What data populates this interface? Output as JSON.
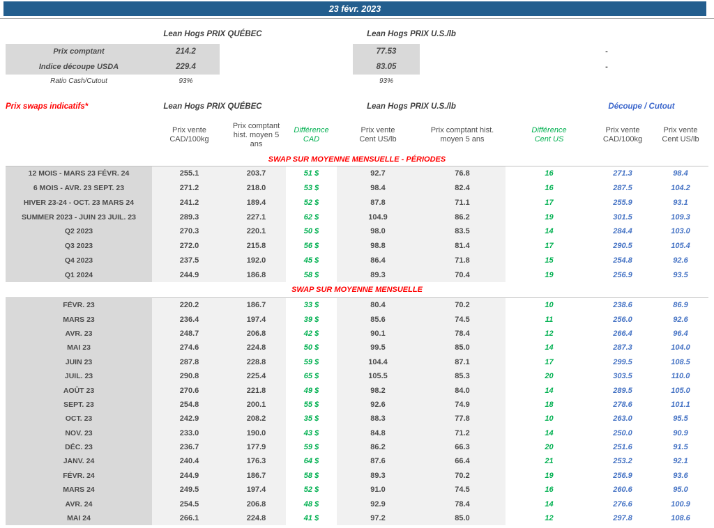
{
  "title_bar": {
    "date": "23 févr. 2023"
  },
  "colors": {
    "header_bar_blue": "#235e8e",
    "difference_green": "#00b050",
    "cutout_blue": "#4472c4",
    "section_red": "#ff0000",
    "label_gray_bg": "#d9d9d9",
    "value_gray_bg": "#f1f1f1"
  },
  "spot": {
    "quebec_header": "Lean Hogs PRIX QUÉBEC",
    "us_header": "Lean Hogs PRIX U.S./lb",
    "rows": [
      {
        "label": "Prix comptant",
        "quebec": "214.2",
        "us": "77.53",
        "right": "-"
      },
      {
        "label": "Indice découpe USDA",
        "quebec": "229.4",
        "us": "83.05",
        "right": "-"
      },
      {
        "label": "Ratio Cash/Cutout",
        "quebec": "93%",
        "us": "93%",
        "right": ""
      }
    ]
  },
  "swaps": {
    "label": "Prix swaps indicatifs*",
    "quebec_header": "Lean Hogs PRIX QUÉBEC",
    "us_header": "Lean Hogs PRIX U.S./lb",
    "cutout_header": "Découpe / Cutout",
    "columns": [
      "Prix vente\nCAD/100kg",
      "Prix comptant\nhist. moyen 5\nans",
      "Différence\nCAD",
      "Prix vente\nCent US/lb",
      "Prix comptant hist.\nmoyen 5 ans",
      "Différence\nCent US",
      "Prix vente\nCAD/100kg",
      "Prix vente\nCent US/lb"
    ],
    "sections": [
      {
        "title": "SWAP SUR MOYENNE MENSUELLE - PÉRIODES",
        "rows": [
          [
            "12 MOIS - MARS 23 FÉVR. 24",
            "255.1",
            "203.7",
            "51 $",
            "92.7",
            "76.8",
            "16",
            "271.3",
            "98.4"
          ],
          [
            "6 MOIS - AVR. 23 SEPT. 23",
            "271.2",
            "218.0",
            "53 $",
            "98.4",
            "82.4",
            "16",
            "287.5",
            "104.2"
          ],
          [
            "HIVER 23-24 - OCT. 23 MARS 24",
            "241.2",
            "189.4",
            "52 $",
            "87.8",
            "71.1",
            "17",
            "255.9",
            "93.1"
          ],
          [
            "SUMMER 2023 - JUIN 23 JUIL. 23",
            "289.3",
            "227.1",
            "62 $",
            "104.9",
            "86.2",
            "19",
            "301.5",
            "109.3"
          ],
          [
            "Q2 2023",
            "270.3",
            "220.1",
            "50 $",
            "98.0",
            "83.5",
            "14",
            "284.4",
            "103.0"
          ],
          [
            "Q3 2023",
            "272.0",
            "215.8",
            "56 $",
            "98.8",
            "81.4",
            "17",
            "290.5",
            "105.4"
          ],
          [
            "Q4 2023",
            "237.5",
            "192.0",
            "45 $",
            "86.4",
            "71.8",
            "15",
            "254.8",
            "92.6"
          ],
          [
            "Q1 2024",
            "244.9",
            "186.8",
            "58 $",
            "89.3",
            "70.4",
            "19",
            "256.9",
            "93.5"
          ]
        ]
      },
      {
        "title": "SWAP SUR MOYENNE MENSUELLE",
        "rows": [
          [
            "FÉVR. 23",
            "220.2",
            "186.7",
            "33 $",
            "80.4",
            "70.2",
            "10",
            "238.6",
            "86.9"
          ],
          [
            "MARS 23",
            "236.4",
            "197.4",
            "39 $",
            "85.6",
            "74.5",
            "11",
            "256.0",
            "92.6"
          ],
          [
            "AVR. 23",
            "248.7",
            "206.8",
            "42 $",
            "90.1",
            "78.4",
            "12",
            "266.4",
            "96.4"
          ],
          [
            "MAI 23",
            "274.6",
            "224.8",
            "50 $",
            "99.5",
            "85.0",
            "14",
            "287.3",
            "104.0"
          ],
          [
            "JUIN 23",
            "287.8",
            "228.8",
            "59 $",
            "104.4",
            "87.1",
            "17",
            "299.5",
            "108.5"
          ],
          [
            "JUIL. 23",
            "290.8",
            "225.4",
            "65 $",
            "105.5",
            "85.3",
            "20",
            "303.5",
            "110.0"
          ],
          [
            "AOÛT 23",
            "270.6",
            "221.8",
            "49 $",
            "98.2",
            "84.0",
            "14",
            "289.5",
            "105.0"
          ],
          [
            "SEPT. 23",
            "254.8",
            "200.1",
            "55 $",
            "92.6",
            "74.9",
            "18",
            "278.6",
            "101.1"
          ],
          [
            "OCT. 23",
            "242.9",
            "208.2",
            "35 $",
            "88.3",
            "77.8",
            "10",
            "263.0",
            "95.5"
          ],
          [
            "NOV. 23",
            "233.0",
            "190.0",
            "43 $",
            "84.8",
            "71.2",
            "14",
            "250.0",
            "90.9"
          ],
          [
            "DÉC. 23",
            "236.7",
            "177.9",
            "59 $",
            "86.2",
            "66.3",
            "20",
            "251.6",
            "91.5"
          ],
          [
            "JANV. 24",
            "240.4",
            "176.3",
            "64 $",
            "87.6",
            "66.4",
            "21",
            "253.2",
            "92.1"
          ],
          [
            "FÉVR. 24",
            "244.9",
            "186.7",
            "58 $",
            "89.3",
            "70.2",
            "19",
            "256.9",
            "93.6"
          ],
          [
            "MARS 24",
            "249.5",
            "197.4",
            "52 $",
            "91.0",
            "74.5",
            "16",
            "260.6",
            "95.0"
          ],
          [
            "AVR. 24",
            "254.5",
            "206.8",
            "48 $",
            "92.9",
            "78.4",
            "14",
            "276.6",
            "100.9"
          ],
          [
            "MAI 24",
            "266.1",
            "224.8",
            "41 $",
            "97.2",
            "85.0",
            "12",
            "297.8",
            "108.6"
          ]
        ]
      }
    ]
  }
}
